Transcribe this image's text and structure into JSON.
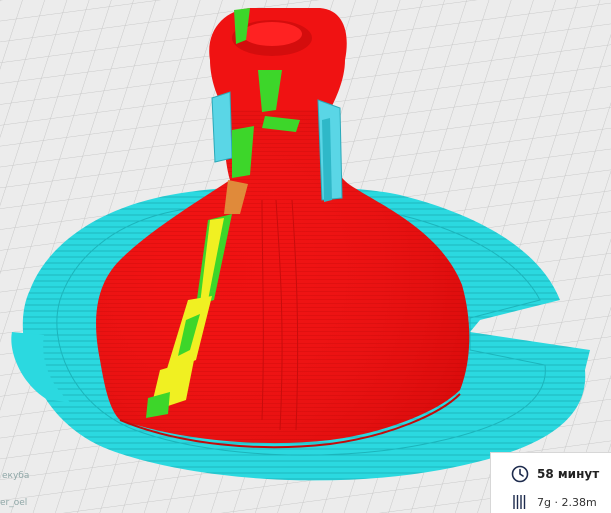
{
  "viewport": {
    "bed_label_1": "екуба",
    "bed_label_2": "er_oel"
  },
  "print_info": {
    "time_label": "58 минут",
    "material_label": "7g · 2.38m",
    "time_icon": "clock-icon",
    "material_icon": "filament-spool-icon"
  },
  "colors": {
    "bed": "#e9e9e9",
    "grid": "#c9c9c9",
    "skirt": "#2bd9e0",
    "wall": "#ee1111",
    "infill": "#3dd62a",
    "support": "#f0f022",
    "support_interface": "#5ad6e6"
  }
}
